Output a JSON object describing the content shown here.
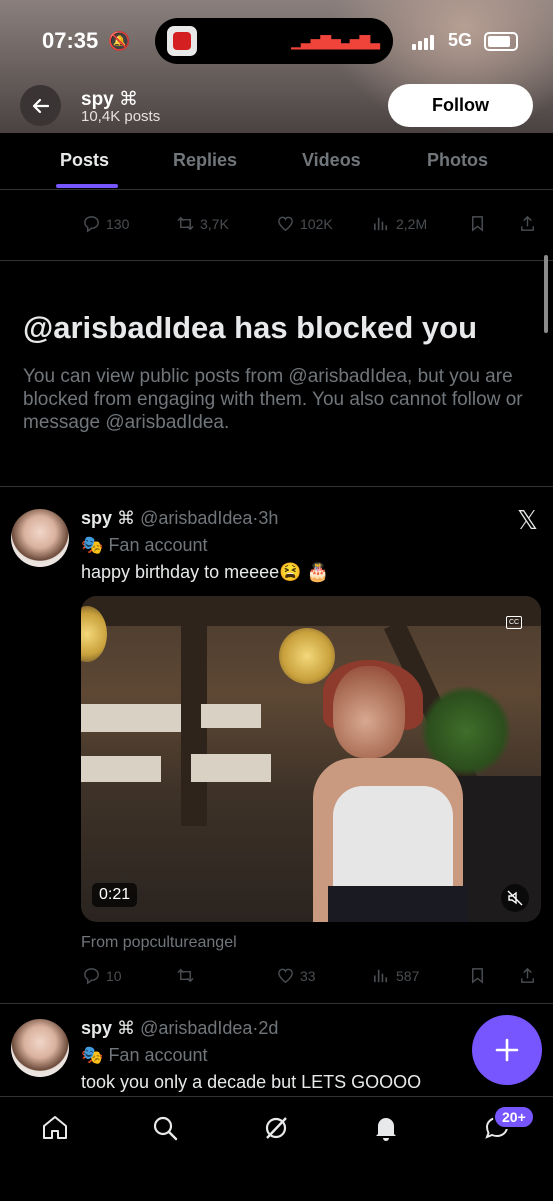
{
  "status_bar": {
    "time": "07:35",
    "network": "5G"
  },
  "header": {
    "account_name": "spy",
    "account_symbol": "⌘",
    "posts_count": "10,4K posts",
    "follow_label": "Follow"
  },
  "tabs": [
    {
      "label": "Posts",
      "active": true
    },
    {
      "label": "Replies"
    },
    {
      "label": "Videos"
    },
    {
      "label": "Photos"
    }
  ],
  "first_post_actions": {
    "replies": "130",
    "reposts": "3,7K",
    "likes": "102K",
    "views": "2,2M"
  },
  "blocked": {
    "title": "@arisbadIdea has blocked you",
    "body": "You can view public posts from @arisbadIdea, but you are blocked from engaging with them. You also cannot follow or message @arisbadIdea."
  },
  "posts": [
    {
      "name": "spy",
      "symbol": "⌘",
      "handle": "@arisbadIdea",
      "time": "3h",
      "label": "Fan account",
      "text": "happy birthday to meeee😫 🎂",
      "video_duration": "0:21",
      "from": "From popcultureangel",
      "actions": {
        "replies": "10",
        "reposts": "",
        "likes": "33",
        "views": "587"
      }
    },
    {
      "name": "spy",
      "symbol": "⌘",
      "handle": "@arisbadIdea",
      "time": "2d",
      "label": "Fan account",
      "text": "took you only a decade but LETS GOOOO"
    }
  ],
  "bottom_nav": {
    "badge": "20+"
  },
  "colors": {
    "accent": "#7856ff",
    "background": "#000000",
    "muted": "#71767b"
  }
}
